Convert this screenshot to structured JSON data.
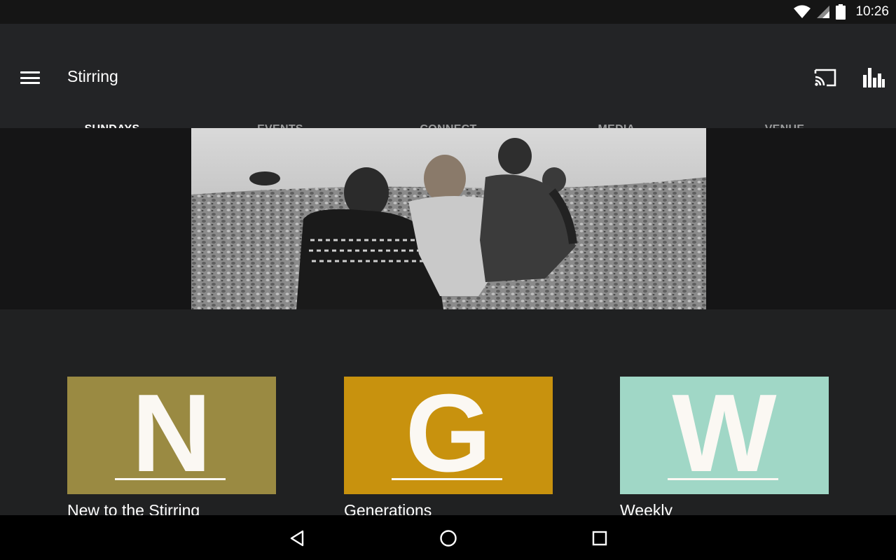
{
  "status_bar": {
    "time": "10:26",
    "icons": [
      "wifi-icon",
      "signal-icon",
      "battery-icon"
    ]
  },
  "app_bar": {
    "title": "Stirring",
    "menu_icon": "hamburger-icon",
    "actions": [
      "cast-icon",
      "stats-icon"
    ]
  },
  "tabs": [
    {
      "label": "SUNDAYS",
      "active": true
    },
    {
      "label": "EVENTS",
      "active": false
    },
    {
      "label": "CONNECT",
      "active": false
    },
    {
      "label": "MEDIA",
      "active": false
    },
    {
      "label": "VENUE",
      "active": false
    }
  ],
  "hero": {
    "image": "black-and-white photo of three people sitting on a pebble beach facing the water"
  },
  "cards": [
    {
      "letter": "N",
      "title": "New to the Stirring",
      "color": "#9a8a42"
    },
    {
      "letter": "G",
      "title": "Generations",
      "color": "#c8920e"
    },
    {
      "letter": "W",
      "title": "Weekly",
      "color": "#a0d7c6"
    }
  ],
  "nav_bar": {
    "buttons": [
      "back-icon",
      "home-icon",
      "recents-icon"
    ]
  },
  "colors": {
    "app_bar": "#232426",
    "background": "#202122",
    "status_bar": "#151515",
    "tab_inactive": "#9a9b9c",
    "tab_active": "#ffffff"
  }
}
